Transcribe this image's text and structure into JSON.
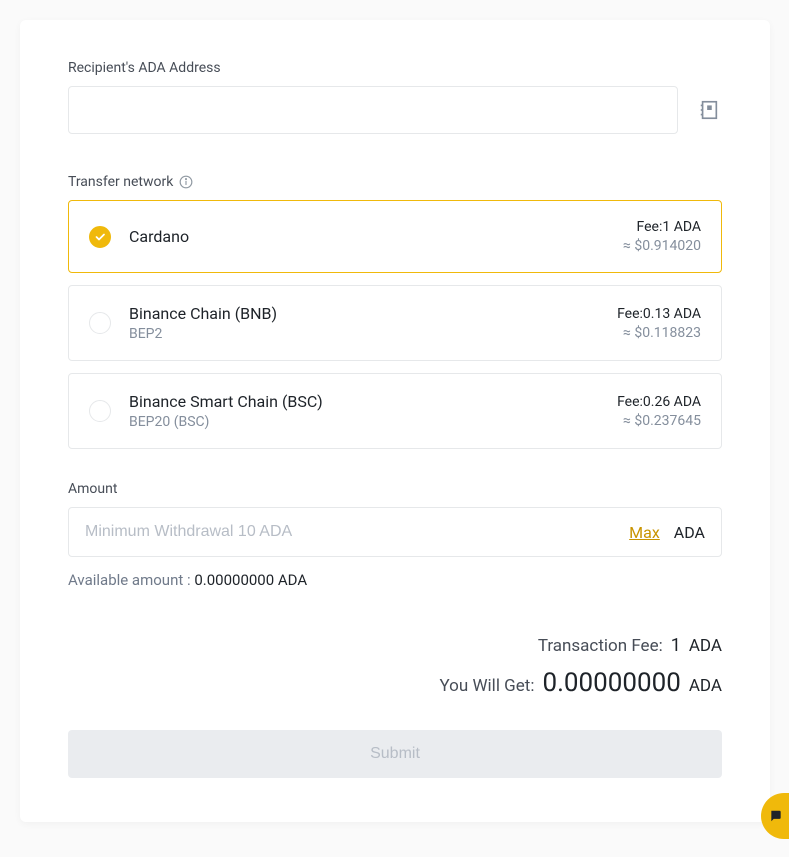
{
  "recipient": {
    "label": "Recipient's ADA Address",
    "value": ""
  },
  "transfer_network": {
    "label": "Transfer network",
    "options": [
      {
        "name": "Cardano",
        "sub": "",
        "fee_label": "Fee:1 ADA",
        "fee_usd": "≈ $0.914020",
        "selected": true
      },
      {
        "name": "Binance Chain (BNB)",
        "sub": "BEP2",
        "fee_label": "Fee:0.13 ADA",
        "fee_usd": "≈ $0.118823",
        "selected": false
      },
      {
        "name": "Binance Smart Chain (BSC)",
        "sub": "BEP20 (BSC)",
        "fee_label": "Fee:0.26 ADA",
        "fee_usd": "≈ $0.237645",
        "selected": false
      }
    ]
  },
  "amount": {
    "label": "Amount",
    "placeholder": "Minimum Withdrawal 10 ADA",
    "max_label": "Max",
    "currency": "ADA",
    "available_label": "Available amount : ",
    "available_value": "0.00000000 ADA"
  },
  "summary": {
    "tx_fee_label": "Transaction Fee:",
    "tx_fee_value": "1",
    "tx_fee_unit": "ADA",
    "you_get_label": "You Will Get:",
    "you_get_value": "0.00000000",
    "you_get_unit": "ADA"
  },
  "submit_label": "Submit"
}
